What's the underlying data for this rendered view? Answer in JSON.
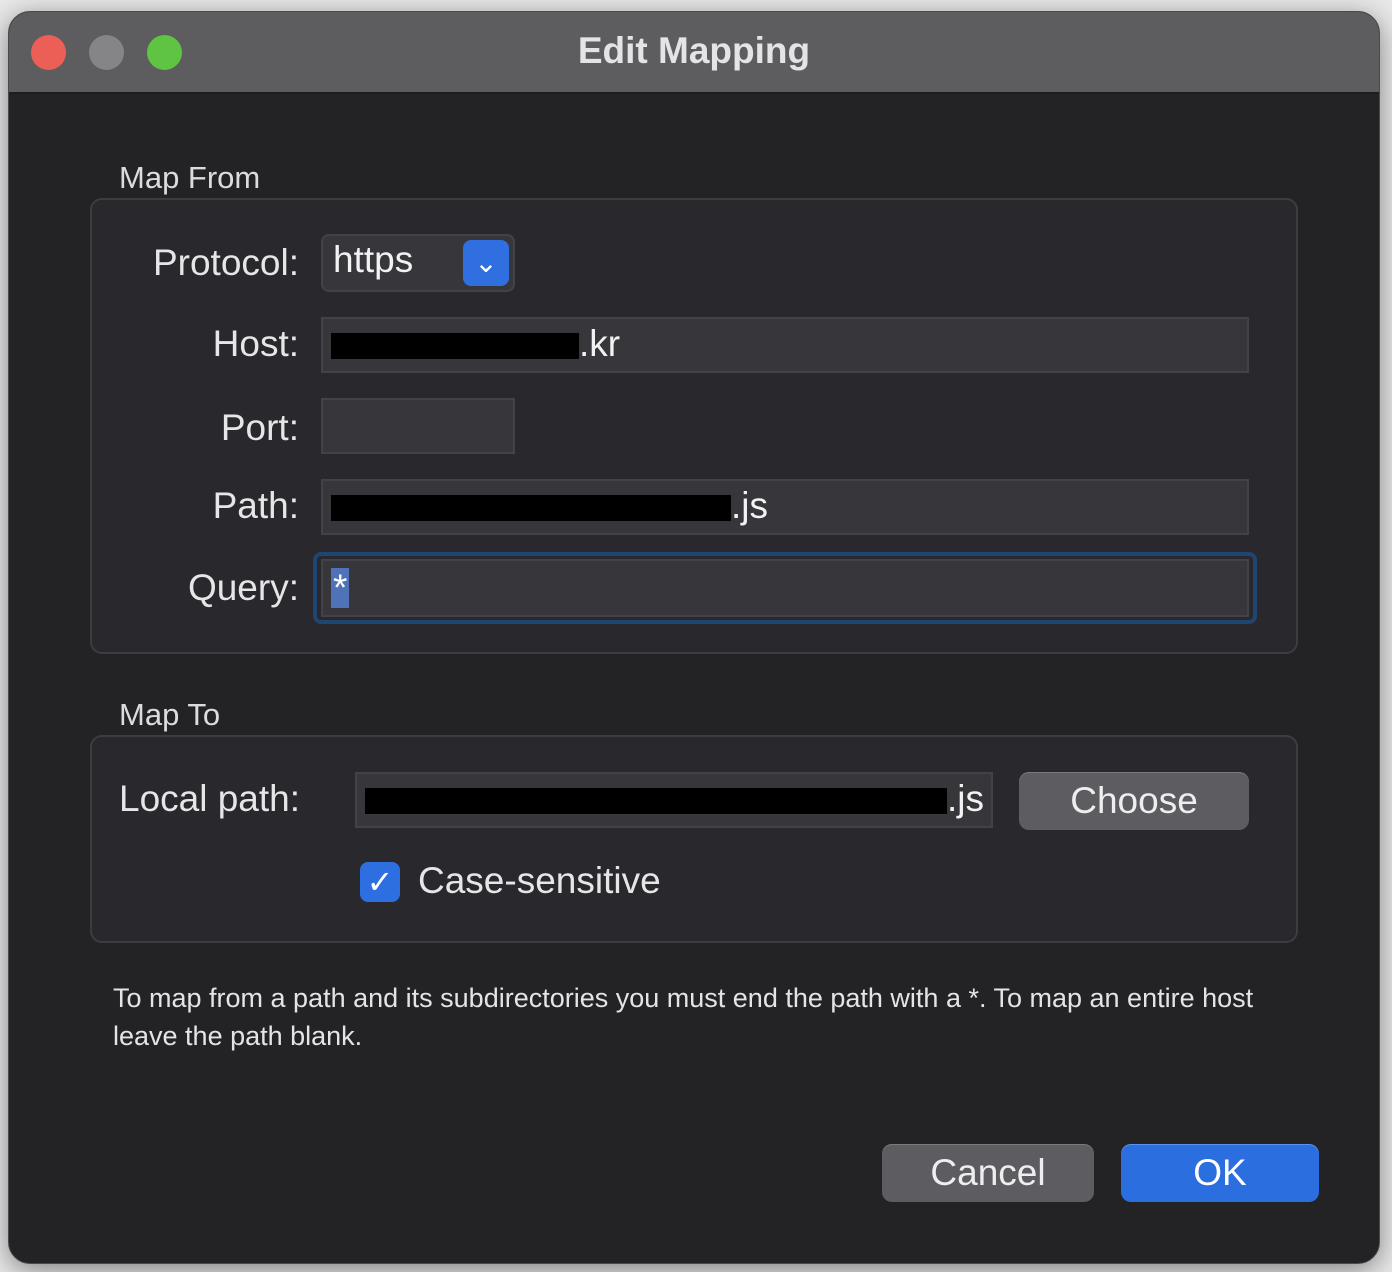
{
  "window": {
    "title": "Edit Mapping"
  },
  "map_from": {
    "section_label": "Map From",
    "protocol_label": "Protocol:",
    "protocol_value": "https",
    "host_label": "Host:",
    "host_suffix": ".kr",
    "port_label": "Port:",
    "port_value": "",
    "path_label": "Path:",
    "path_suffix": ".js",
    "query_label": "Query:",
    "query_value": "*"
  },
  "map_to": {
    "section_label": "Map To",
    "local_path_label": "Local path:",
    "local_path_suffix": ".js",
    "choose_label": "Choose",
    "case_sensitive_label": "Case-sensitive",
    "case_sensitive_checked": true
  },
  "help": {
    "text": "To map from a path and its subdirectories you must end the path with a *. To map an entire host leave the path blank."
  },
  "footer": {
    "cancel_label": "Cancel",
    "ok_label": "OK"
  },
  "colors": {
    "accent": "#2a6edf",
    "window_bg": "#232225",
    "titlebar_bg": "#5d5c5f"
  }
}
